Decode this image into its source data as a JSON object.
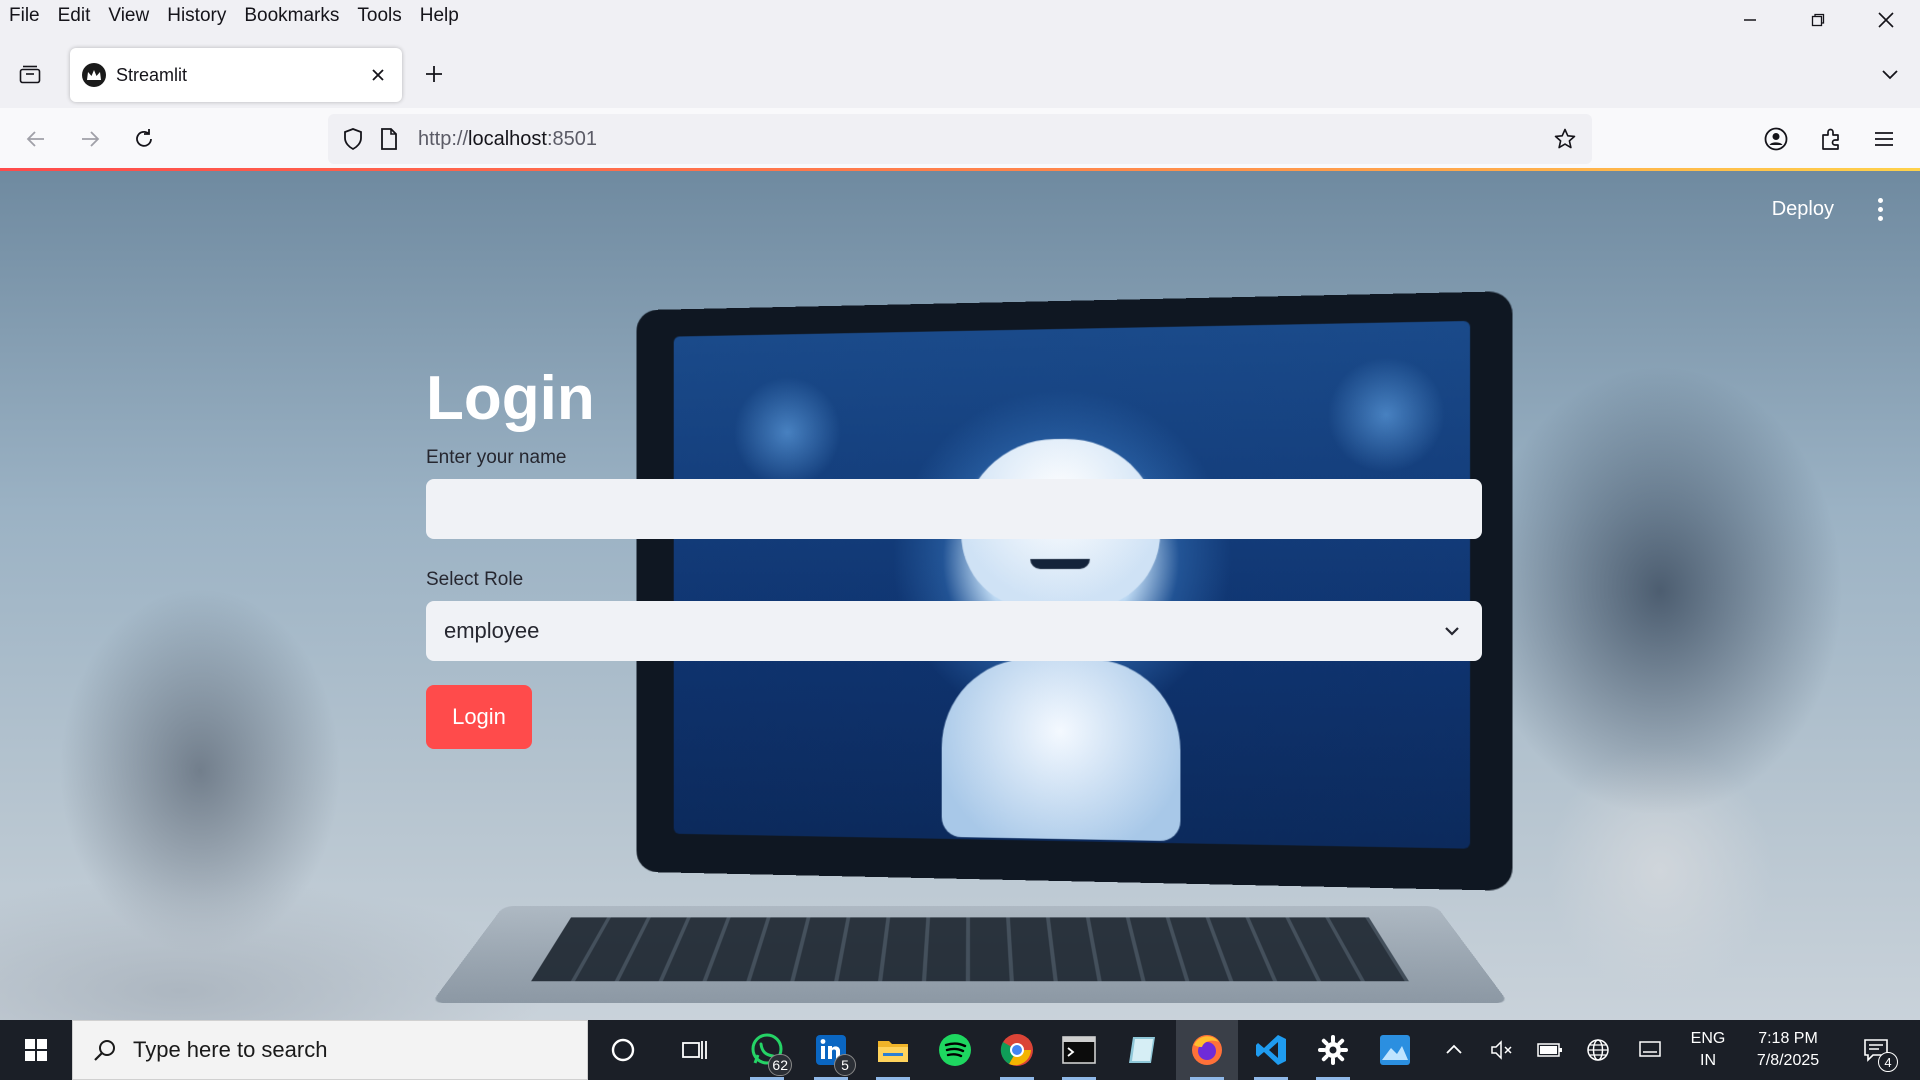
{
  "menubar": {
    "items": [
      {
        "label": "File"
      },
      {
        "label": "Edit"
      },
      {
        "label": "View"
      },
      {
        "label": "History"
      },
      {
        "label": "Bookmarks"
      },
      {
        "label": "Tools"
      },
      {
        "label": "Help"
      }
    ]
  },
  "window_controls": {
    "icons": [
      "minimize-icon",
      "restore-icon",
      "close-icon"
    ]
  },
  "tabs": [
    {
      "title": "Streamlit",
      "active": true,
      "favicon": "streamlit-crown-icon"
    }
  ],
  "navbar": {
    "url_scheme": "http://",
    "url_host": "localhost",
    "url_port": ":8501"
  },
  "streamlit_header": {
    "deploy_label": "Deploy"
  },
  "form": {
    "title": "Login",
    "name_label": "Enter your name",
    "name_value": "",
    "role_label": "Select Role",
    "role_value": "employee",
    "submit_label": "Login"
  },
  "colors": {
    "primary": "#ff4b4b",
    "input_bg": "#f0f2f6",
    "taskbar_bg": "#1b1f27"
  },
  "taskbar": {
    "search_placeholder": "Type here to search",
    "apps": [
      {
        "name": "cortana-icon"
      },
      {
        "name": "task-view-icon"
      },
      {
        "name": "whatsapp-icon",
        "badge": "62"
      },
      {
        "name": "linkedin-icon",
        "badge": "5"
      },
      {
        "name": "file-explorer-icon"
      },
      {
        "name": "spotify-icon"
      },
      {
        "name": "chrome-icon"
      },
      {
        "name": "terminal-icon"
      },
      {
        "name": "notes-app-icon"
      },
      {
        "name": "firefox-icon"
      },
      {
        "name": "vscode-icon"
      },
      {
        "name": "settings-icon"
      },
      {
        "name": "photos-app-icon"
      }
    ],
    "tray": {
      "lang_line1": "ENG",
      "lang_line2": "IN",
      "time": "7:18 PM",
      "date": "7/8/2025",
      "notification_count": "4"
    }
  }
}
